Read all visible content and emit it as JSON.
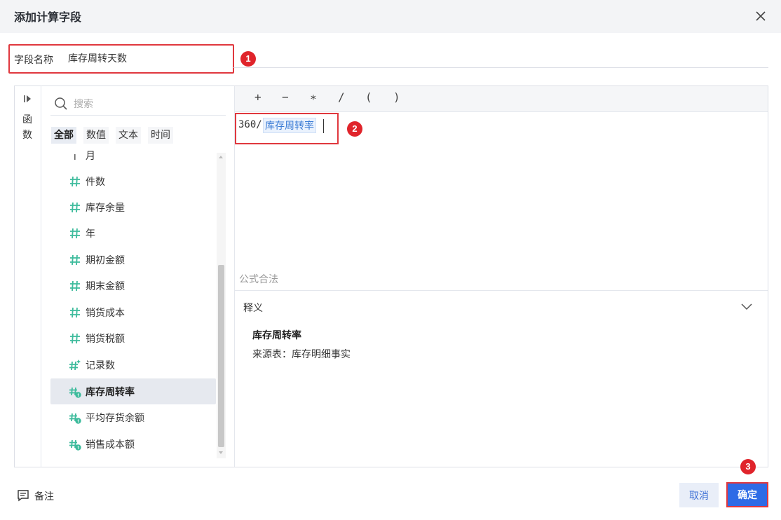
{
  "dialog": {
    "title": "添加计算字段"
  },
  "name_field": {
    "label": "字段名称",
    "value": "库存周转天数"
  },
  "badges": {
    "one": "1",
    "two": "2",
    "three": "3"
  },
  "sidebar": {
    "function_tab_label": "函数",
    "function_tab_chars": [
      "函",
      "数"
    ]
  },
  "search": {
    "placeholder": "搜索"
  },
  "filter_tabs": [
    {
      "label": "全部",
      "active": true
    },
    {
      "label": "数值",
      "active": false
    },
    {
      "label": "文本",
      "active": false
    },
    {
      "label": "时间",
      "active": false
    }
  ],
  "fields": [
    {
      "label": "月",
      "icon": "dimension-icon",
      "type": "dimension"
    },
    {
      "label": "件数",
      "icon": "number-icon",
      "type": "number"
    },
    {
      "label": "库存余量",
      "icon": "number-icon",
      "type": "number"
    },
    {
      "label": "年",
      "icon": "number-icon",
      "type": "number"
    },
    {
      "label": "期初金额",
      "icon": "number-icon",
      "type": "number"
    },
    {
      "label": "期末金额",
      "icon": "number-icon",
      "type": "number"
    },
    {
      "label": "销货成本",
      "icon": "number-icon",
      "type": "number"
    },
    {
      "label": "销货税额",
      "icon": "number-icon",
      "type": "number"
    },
    {
      "label": "记录数",
      "icon": "calc-number-icon",
      "type": "calc"
    },
    {
      "label": "库存周转率",
      "icon": "calc-formula-number-icon",
      "type": "calc-formula",
      "selected": true
    },
    {
      "label": "平均存货余额",
      "icon": "calc-formula-number-icon",
      "type": "calc-formula"
    },
    {
      "label": "销售成本额",
      "icon": "calc-formula-number-icon",
      "type": "calc-formula"
    }
  ],
  "operators": [
    "+",
    "−",
    "∗",
    "/",
    "(",
    ")"
  ],
  "formula": {
    "prefix": "360/",
    "field": "库存周转率"
  },
  "status_text": "公式合法",
  "definition": {
    "title": "释义",
    "field_name": "库存周转率",
    "source": "来源表：库存明细事实"
  },
  "footer": {
    "note_label": "备注",
    "cancel_label": "取消",
    "ok_label": "确定"
  },
  "colors": {
    "accent": "#2e6be6",
    "highlight": "#e0383e",
    "badge": "#e0242b",
    "number_icon": "#3dbb9c",
    "formula_badge": "#e8a33d"
  }
}
